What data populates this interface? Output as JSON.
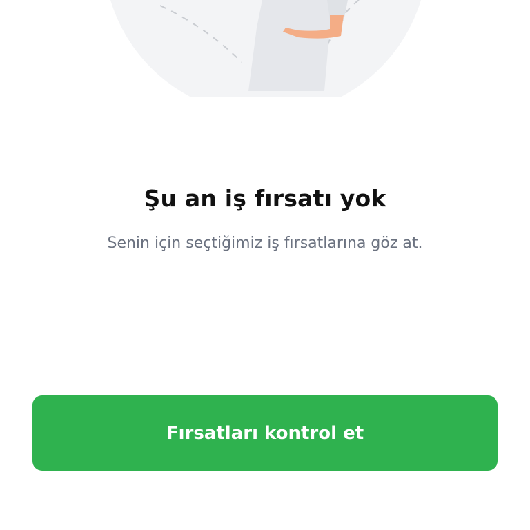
{
  "empty_state": {
    "illustration": "person-with-empty-list-illustration",
    "title": "Şu an iş fırsatı yok",
    "subtitle": "Senin için seçtiğimiz iş fırsatlarına göz at."
  },
  "actions": {
    "primary_label": "Fırsatları kontrol et"
  },
  "colors": {
    "accent": "#2fb24f",
    "title": "#111111",
    "subtitle": "#6b7280",
    "illustration_bg": "#f3f4f6"
  }
}
